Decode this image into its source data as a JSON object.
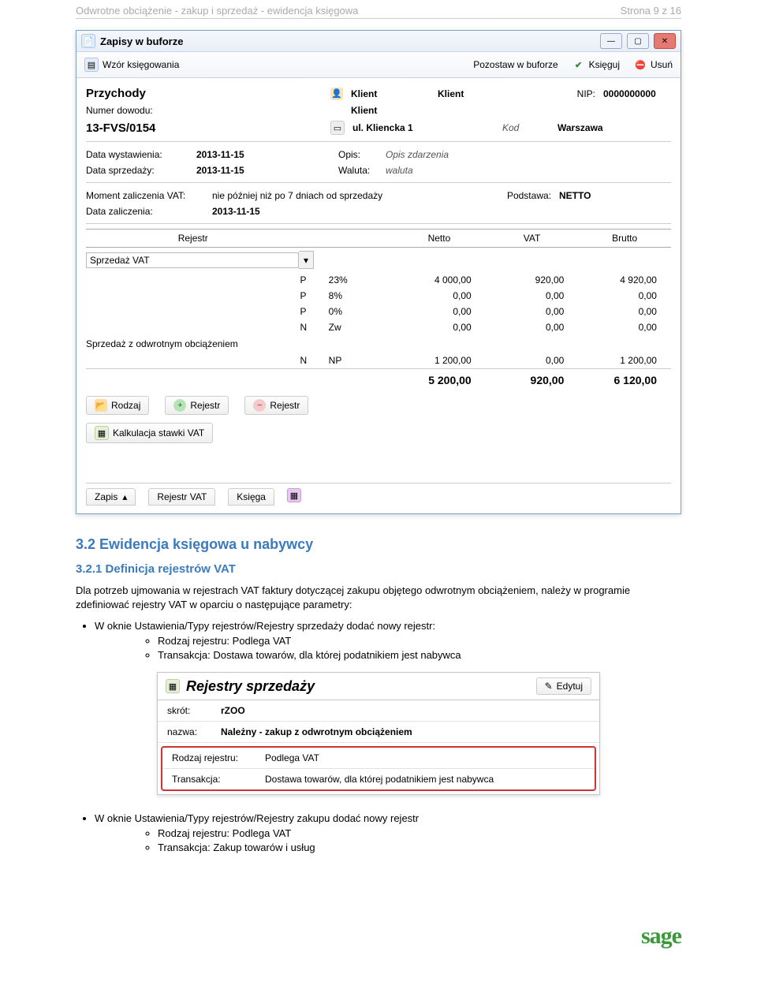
{
  "header": {
    "left": "Odwrotne obciążenie - zakup i sprzedaż - ewidencja księgowa",
    "right": "Strona 9 z 16"
  },
  "window": {
    "title": "Zapisy w buforze",
    "toolbar": {
      "wzor": "Wzór księgowania",
      "buffer": "Pozostaw w buforze",
      "ksieguj": "Księguj",
      "usun": "Usuń"
    },
    "info": {
      "przychody": "Przychody",
      "klient_lbl": "Klient",
      "klient_val": "Klient",
      "nip_lbl": "NIP:",
      "nip_val": "0000000000",
      "numer_lbl": "Numer dowodu:",
      "klient2_lbl": "Klient",
      "doc_no": "13-FVS/0154",
      "adres": "ul. Kliencka 1",
      "kod_lbl": "Kod",
      "miasto": "Warszawa",
      "data_wyst_lbl": "Data wystawienia:",
      "data_wyst": "2013-11-15",
      "opis_lbl": "Opis:",
      "opis_val": "Opis zdarzenia",
      "data_sprz_lbl": "Data sprzedaży:",
      "data_sprz": "2013-11-15",
      "waluta_lbl": "Waluta:",
      "waluta_val": "waluta",
      "moment_lbl": "Moment zaliczenia VAT:",
      "moment_val": "nie później niż po 7 dniach od sprzedaży",
      "podstawa_lbl": "Podstawa:",
      "podstawa_val": "NETTO",
      "data_zal_lbl": "Data zaliczenia:",
      "data_zal": "2013-11-15"
    },
    "table": {
      "h_rejestr": "Rejestr",
      "h_netto": "Netto",
      "h_vat": "VAT",
      "h_brutto": "Brutto",
      "reg1": "Sprzedaż VAT",
      "reg2": "Sprzedaż z odwrotnym obciążeniem",
      "rows": [
        {
          "pn": "P",
          "rate": "23%",
          "netto": "4 000,00",
          "vat": "920,00",
          "brutto": "4 920,00"
        },
        {
          "pn": "P",
          "rate": "8%",
          "netto": "0,00",
          "vat": "0,00",
          "brutto": "0,00"
        },
        {
          "pn": "P",
          "rate": "0%",
          "netto": "0,00",
          "vat": "0,00",
          "brutto": "0,00"
        },
        {
          "pn": "N",
          "rate": "Zw",
          "netto": "0,00",
          "vat": "0,00",
          "brutto": "0,00"
        }
      ],
      "rows2": [
        {
          "pn": "N",
          "rate": "NP",
          "netto": "1 200,00",
          "vat": "0,00",
          "brutto": "1 200,00"
        }
      ],
      "totals": {
        "netto": "5 200,00",
        "vat": "920,00",
        "brutto": "6 120,00"
      }
    },
    "buttons": {
      "rodzaj": "Rodzaj",
      "rejestr_plus": "Rejestr",
      "rejestr_minus": "Rejestr",
      "kalkulacja": "Kalkulacja stawki VAT"
    },
    "tabs": {
      "zapis": "Zapis",
      "rejestr": "Rejestr VAT",
      "ksiega": "Księga"
    }
  },
  "headings": {
    "s32": "3.2   Ewidencja księgowa u nabywcy",
    "s321": "3.2.1  Definicja rejestrów VAT"
  },
  "text": {
    "p1": "Dla potrzeb ujmowania w rejestrach VAT faktury dotyczącej zakupu objętego odwrotnym obciążeniem, należy w programie zdefiniować rejestry VAT w oparciu o następujące parametry:",
    "b1": "W oknie Ustawienia/Typy rejestrów/Rejestry sprzedaży dodać nowy rejestr:",
    "b1a": "Rodzaj rejestru: Podlega VAT",
    "b1b": "Transakcja: Dostawa towarów, dla której podatnikiem jest nabywca",
    "b2": "W oknie Ustawienia/Typy rejestrów/Rejestry zakupu dodać nowy rejestr",
    "b2a": "Rodzaj rejestru: Podlega VAT",
    "b2b": "Transakcja: Zakup towarów i usług"
  },
  "panel": {
    "title": "Rejestry sprzedaży",
    "edit": "Edytuj",
    "skrot_lbl": "skrót:",
    "skrot_val": "rZOO",
    "nazwa_lbl": "nazwa:",
    "nazwa_val": "Należny - zakup z odwrotnym obciążeniem",
    "rodzaj_lbl": "Rodzaj rejestru:",
    "rodzaj_val": "Podlega VAT",
    "trans_lbl": "Transakcja:",
    "trans_val": "Dostawa towarów, dla której podatnikiem jest nabywca"
  },
  "footer": {
    "brand": "sage"
  }
}
